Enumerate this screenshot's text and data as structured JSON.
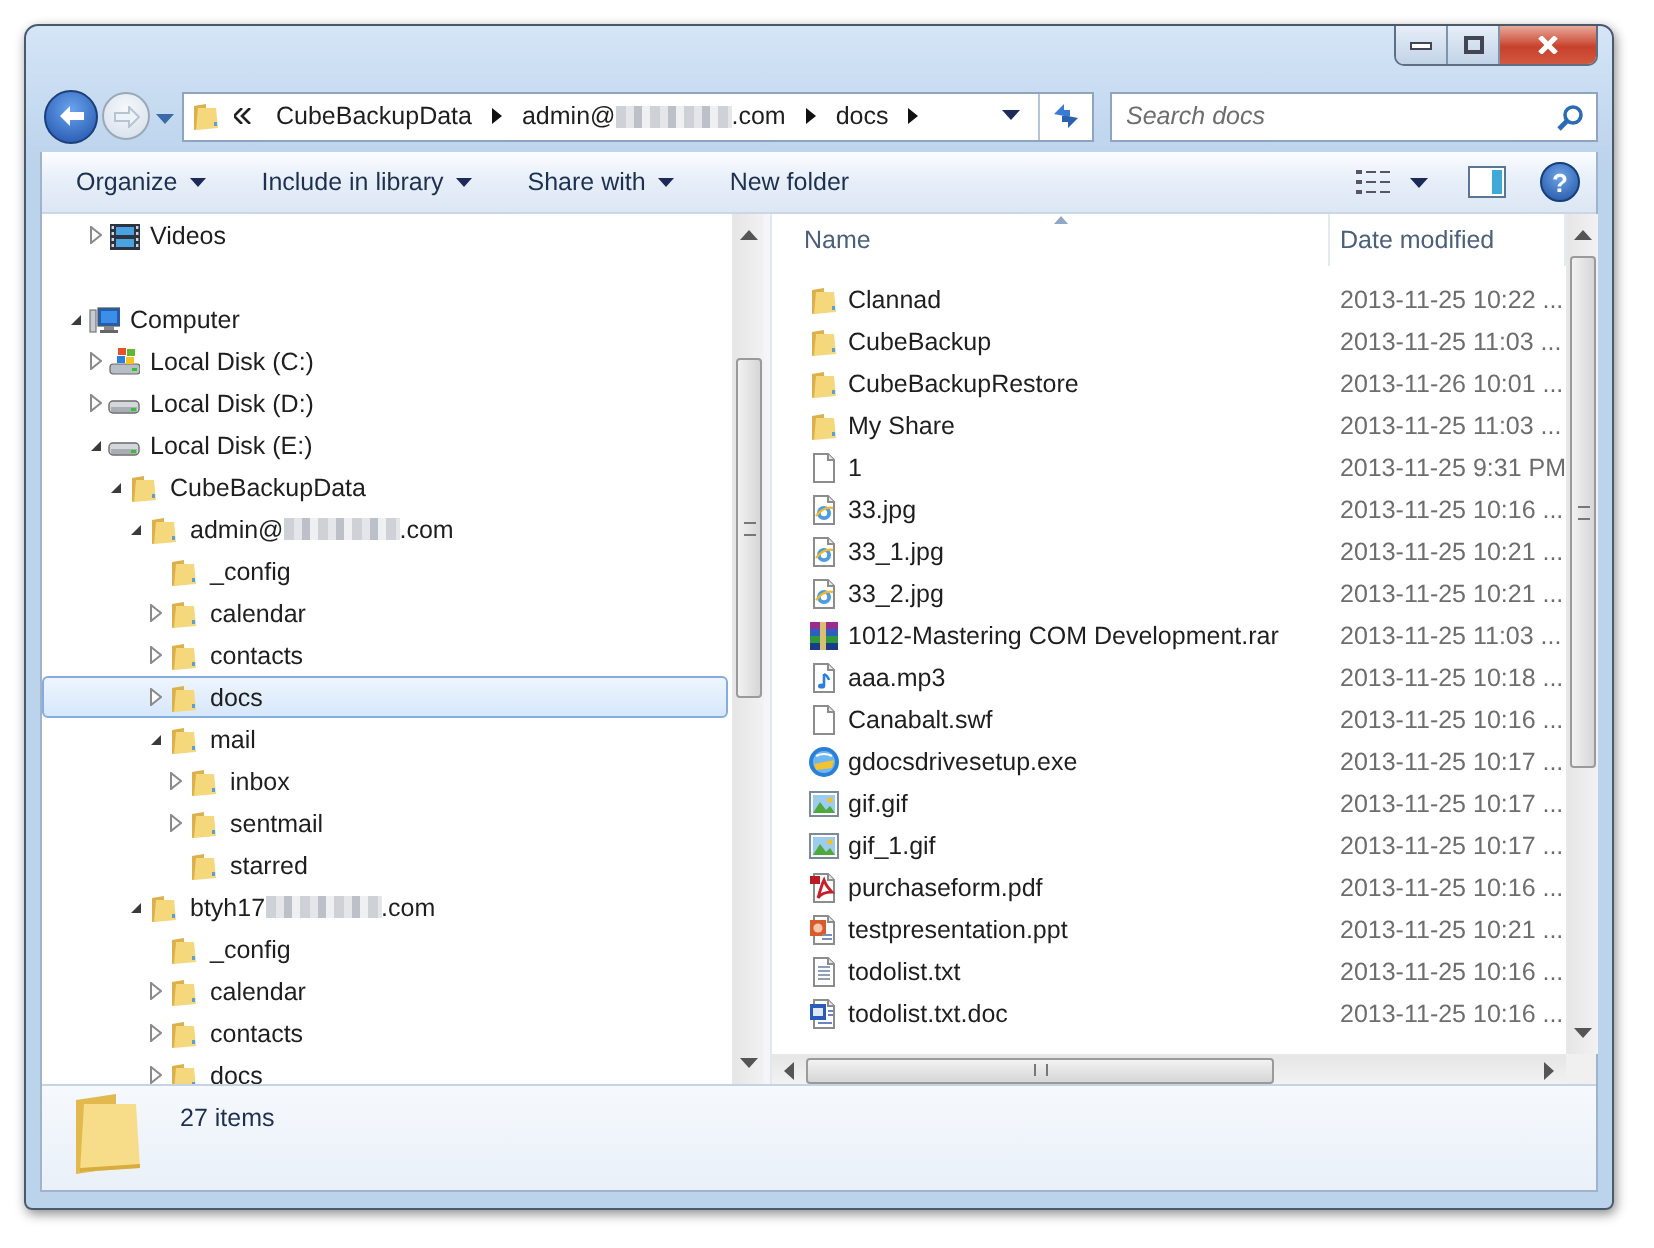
{
  "address": {
    "crumbs": [
      {
        "text": "CubeBackupData"
      },
      {
        "text": "admin@",
        "redacted": true,
        "text_after": ".com"
      },
      {
        "text": "docs"
      }
    ]
  },
  "search": {
    "placeholder": "Search docs"
  },
  "toolbar": {
    "commands": [
      {
        "label": "Organize",
        "dropdown": true
      },
      {
        "label": "Include in library",
        "dropdown": true
      },
      {
        "label": "Share with",
        "dropdown": true
      },
      {
        "label": "New folder"
      }
    ],
    "help": "?"
  },
  "navigation": {
    "library_items": [
      {
        "label": "Videos",
        "kind": "video",
        "expanded": false,
        "selected": false
      }
    ],
    "computer": {
      "label": "Computer",
      "kind": "computer",
      "expanded": true,
      "selected": false,
      "children": [
        {
          "label": "Local Disk (C:)",
          "kind": "system-drive",
          "expanded": false,
          "selected": false
        },
        {
          "label": "Local Disk (D:)",
          "kind": "drive",
          "expanded": false,
          "selected": false
        },
        {
          "label": "Local Disk (E:)",
          "kind": "drive",
          "expanded": true,
          "selected": false,
          "children": [
            {
              "label": "CubeBackupData",
              "kind": "folder",
              "expanded": true,
              "selected": false,
              "children": [
                {
                  "label": "admin@",
                  "label_after": ".com",
                  "redacted": true,
                  "kind": "folder",
                  "expanded": true,
                  "selected": false,
                  "children": [
                    {
                      "label": "_config",
                      "kind": "folder",
                      "selected": false
                    },
                    {
                      "label": "calendar",
                      "kind": "folder",
                      "expanded": false,
                      "selected": false
                    },
                    {
                      "label": "contacts",
                      "kind": "folder",
                      "expanded": false,
                      "selected": false
                    },
                    {
                      "label": "docs",
                      "kind": "folder",
                      "expanded": false,
                      "selected": true
                    },
                    {
                      "label": "mail",
                      "kind": "folder",
                      "expanded": true,
                      "selected": false,
                      "children": [
                        {
                          "label": "inbox",
                          "kind": "folder",
                          "expanded": false,
                          "selected": false
                        },
                        {
                          "label": "sentmail",
                          "kind": "folder",
                          "expanded": false,
                          "selected": false
                        },
                        {
                          "label": "starred",
                          "kind": "folder",
                          "selected": false
                        }
                      ]
                    }
                  ]
                },
                {
                  "label": "btyh17",
                  "label_after": ".com",
                  "redacted": true,
                  "kind": "folder",
                  "expanded": true,
                  "selected": false,
                  "children": [
                    {
                      "label": "_config",
                      "kind": "folder",
                      "selected": false
                    },
                    {
                      "label": "calendar",
                      "kind": "folder",
                      "expanded": false,
                      "selected": false
                    },
                    {
                      "label": "contacts",
                      "kind": "folder",
                      "expanded": false,
                      "selected": false
                    },
                    {
                      "label": "docs",
                      "kind": "folder",
                      "expanded": false,
                      "selected": false
                    }
                  ]
                }
              ]
            }
          ]
        }
      ]
    }
  },
  "file_list": {
    "columns": [
      {
        "label": "Name",
        "sorted": true
      },
      {
        "label": "Date modified"
      }
    ],
    "rows": [
      {
        "name": "Clannad",
        "date": "2013-11-25 10:22 ...",
        "kind": "folder"
      },
      {
        "name": "CubeBackup",
        "date": "2013-11-25 11:03 ...",
        "kind": "folder"
      },
      {
        "name": "CubeBackupRestore",
        "date": "2013-11-26 10:01 ...",
        "kind": "folder"
      },
      {
        "name": "My Share",
        "date": "2013-11-25 11:03 ...",
        "kind": "folder"
      },
      {
        "name": "1",
        "date": "2013-11-25 9:31 PM",
        "kind": "blank"
      },
      {
        "name": "33.jpg",
        "date": "2013-11-25 10:16 ...",
        "kind": "jpg"
      },
      {
        "name": "33_1.jpg",
        "date": "2013-11-25 10:21 ...",
        "kind": "jpg"
      },
      {
        "name": "33_2.jpg",
        "date": "2013-11-25 10:21 ...",
        "kind": "jpg"
      },
      {
        "name": "1012-Mastering COM Development.rar",
        "date": "2013-11-25 11:03 ...",
        "kind": "rar"
      },
      {
        "name": "aaa.mp3",
        "date": "2013-11-25 10:18 ...",
        "kind": "mp3"
      },
      {
        "name": "Canabalt.swf",
        "date": "2013-11-25 10:16 ...",
        "kind": "blank"
      },
      {
        "name": "gdocsdrivesetup.exe",
        "date": "2013-11-25 10:17 ...",
        "kind": "exe"
      },
      {
        "name": "gif.gif",
        "date": "2013-11-25 10:17 ...",
        "kind": "gif"
      },
      {
        "name": "gif_1.gif",
        "date": "2013-11-25 10:17 ...",
        "kind": "gif"
      },
      {
        "name": "purchaseform.pdf",
        "date": "2013-11-25 10:16 ...",
        "kind": "pdf"
      },
      {
        "name": "testpresentation.ppt",
        "date": "2013-11-25 10:21 ...",
        "kind": "ppt"
      },
      {
        "name": "todolist.txt",
        "date": "2013-11-25 10:16 ...",
        "kind": "txt"
      },
      {
        "name": "todolist.txt.doc",
        "date": "2013-11-25 10:16 ...",
        "kind": "doc"
      }
    ]
  },
  "details": {
    "item_count": "27 items"
  }
}
